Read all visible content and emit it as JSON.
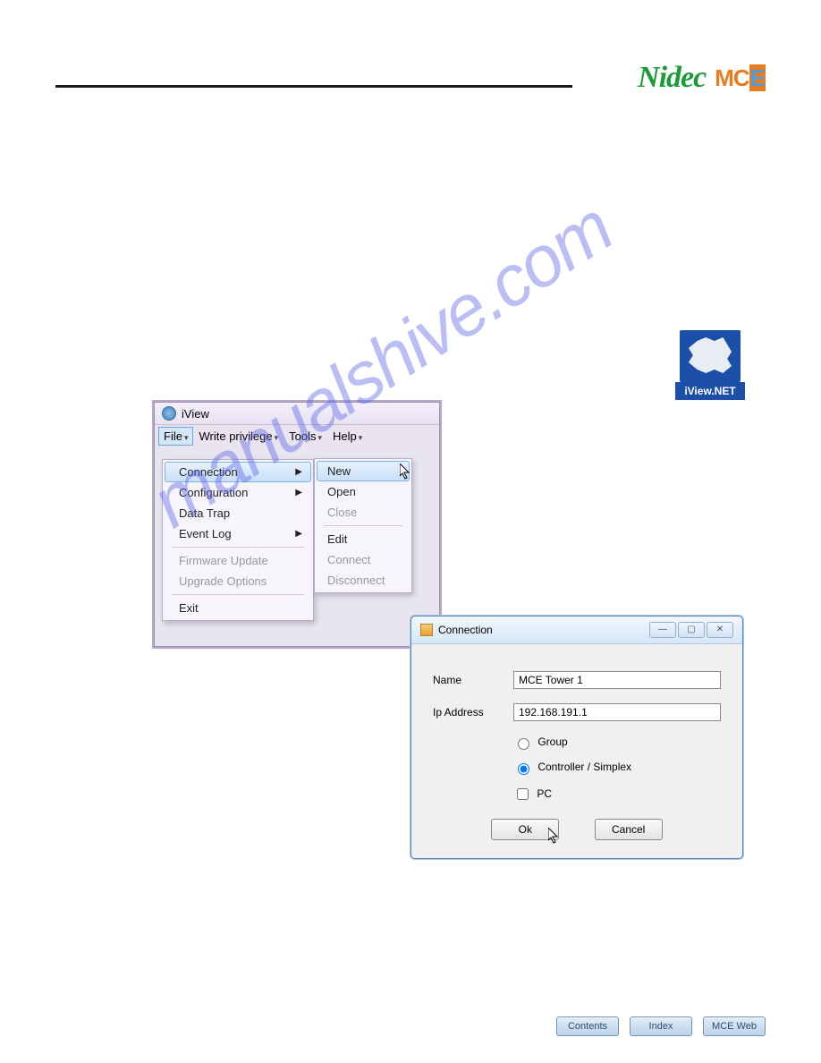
{
  "header": {
    "logo1": "Nidec",
    "logo2_m": "M",
    "logo2_c": "C",
    "logo2_e": "E"
  },
  "watermark": "manualshive.com",
  "desktop_icon": {
    "label": "iView.NET"
  },
  "app": {
    "title": "iView",
    "menubar": {
      "file": "File",
      "write_priv": "Write privilege",
      "tools": "Tools",
      "help": "Help"
    },
    "file_menu": {
      "connection": "Connection",
      "configuration": "Configuration",
      "data_trap": "Data Trap",
      "event_log": "Event Log",
      "firmware_update": "Firmware Update",
      "upgrade_options": "Upgrade Options",
      "exit": "Exit"
    },
    "connection_submenu": {
      "new": "New",
      "open": "Open",
      "close": "Close",
      "edit": "Edit",
      "connect": "Connect",
      "disconnect": "Disconnect"
    }
  },
  "dialog": {
    "title": "Connection",
    "name_label": "Name",
    "name_value": "MCE Tower 1",
    "ip_label": "Ip Address",
    "ip_value": "192.168.191.1",
    "radio_group": "Group",
    "radio_controller": "Controller / Simplex",
    "check_pc": "PC",
    "ok": "Ok",
    "cancel": "Cancel"
  },
  "footer": {
    "contents": "Contents",
    "index": "Index",
    "mceweb": "MCE Web"
  }
}
